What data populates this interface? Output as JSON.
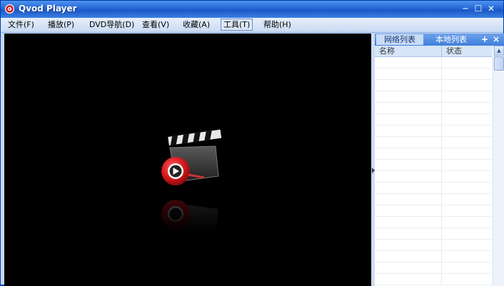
{
  "window": {
    "title": "Qvod Player"
  },
  "titlebar": {
    "minimize": "─",
    "maximize": "☐",
    "close": "✕"
  },
  "menu": {
    "items": [
      {
        "label": "文件(F)"
      },
      {
        "label": "播放(P)"
      },
      {
        "label": "DVD导航(D)"
      },
      {
        "label": "查看(V)"
      },
      {
        "label": "收藏(A)"
      },
      {
        "label": "工具(T)"
      },
      {
        "label": "帮助(H)"
      }
    ],
    "active_index": 5
  },
  "panel": {
    "tabs": [
      {
        "label": "网络列表",
        "selected": true
      },
      {
        "label": "本地列表",
        "selected": false
      }
    ],
    "add_button": "+",
    "close_button": "×",
    "columns": {
      "name": "名称",
      "status": "状态"
    },
    "rows": []
  },
  "colors": {
    "title_bar": "#2467d7",
    "video_background": "#000000",
    "logo_red": "#d2151b"
  }
}
